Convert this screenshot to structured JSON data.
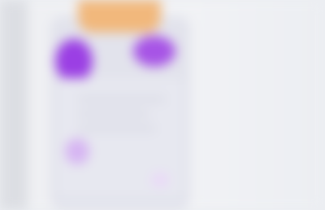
{
  "header": {
    "label": ""
  },
  "colors": {
    "background": "#eceef2",
    "card": "#e2e3ec",
    "accent_orange": "#f1b87c",
    "accent_purple": "#9b3fe4",
    "accent_purple_light": "#d6b4f2"
  },
  "icons": {
    "left_avatar": "avatar-icon",
    "right_avatar": "avatar-icon",
    "bottom_left": "dot-icon",
    "bottom_right": "dot-icon"
  }
}
